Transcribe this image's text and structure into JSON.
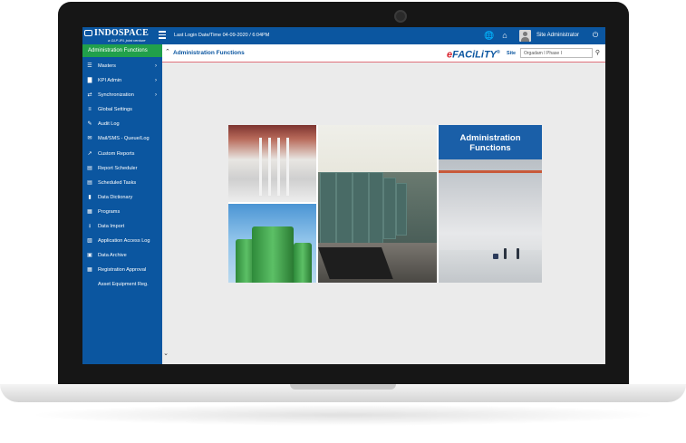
{
  "header": {
    "logo_text": "INDOSPACE",
    "logo_tagline": "a GLP-IPL joint venture",
    "last_login": "Last Login Date/Time 04-09-2020 / 6:04PM",
    "user_name": "Site Administrator"
  },
  "sidebar": {
    "active_item": "Administration Functions",
    "items": [
      {
        "label": "Masters",
        "icon": "list-icon",
        "has_submenu": true
      },
      {
        "label": "KPI Admin",
        "icon": "bar-chart-icon",
        "has_submenu": true
      },
      {
        "label": "Synchronization",
        "icon": "sync-icon",
        "has_submenu": true
      },
      {
        "label": "Global Settings",
        "icon": "sliders-icon",
        "has_submenu": false
      },
      {
        "label": "Audit Log",
        "icon": "edit-icon",
        "has_submenu": false
      },
      {
        "label": "Mail/SMS - Queue/Log",
        "icon": "mail-icon",
        "has_submenu": false
      },
      {
        "label": "Custom Reports",
        "icon": "line-chart-icon",
        "has_submenu": false
      },
      {
        "label": "Report Scheduler",
        "icon": "file-icon",
        "has_submenu": false
      },
      {
        "label": "Scheduled Tasks",
        "icon": "file-text-icon",
        "has_submenu": false
      },
      {
        "label": "Data Dictionary",
        "icon": "book-icon",
        "has_submenu": false
      },
      {
        "label": "Programs",
        "icon": "table-icon",
        "has_submenu": false
      },
      {
        "label": "Data Import",
        "icon": "download-icon",
        "has_submenu": false
      },
      {
        "label": "Application Access Log",
        "icon": "document-icon",
        "has_submenu": false
      },
      {
        "label": "Data Archive",
        "icon": "archive-icon",
        "has_submenu": false
      },
      {
        "label": "Registration Approval",
        "icon": "grid-icon",
        "has_submenu": false
      },
      {
        "label": "Asset Equipment Reg.",
        "icon": "",
        "has_submenu": false
      }
    ]
  },
  "content": {
    "page_title": "Administration Functions",
    "brand_e": "e",
    "brand_rest": "FACiLiTY",
    "brand_mark": "®",
    "site_label": "Site",
    "site_input_value": "Orgadam I Phase I",
    "banner_title": "Administration Functions"
  },
  "colors": {
    "primary_blue": "#0b56a0",
    "active_green": "#21a04b",
    "brand_red": "#d9232e",
    "header_rule": "#e0707a"
  }
}
